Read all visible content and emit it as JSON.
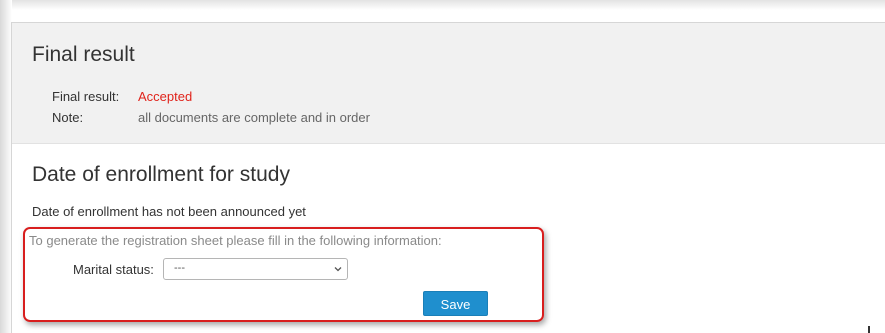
{
  "final_result": {
    "title": "Final result",
    "result_label": "Final result:",
    "result_value": "Accepted",
    "note_label": "Note:",
    "note_value": "all documents are complete and in order"
  },
  "enrollment": {
    "title": "Date of enrollment for study",
    "announce_text": "Date of enrollment has not been announced yet",
    "generate_text": "To generate the registration sheet please fill in the following information:",
    "marital_label": "Marital status:",
    "marital_value": "---",
    "save_label": "Save"
  },
  "colors": {
    "accepted": "#e0241c",
    "save_button": "#1f8fce",
    "highlight_border": "#d81e1e",
    "section_bg": "#f1f1f1"
  },
  "icons": {
    "select_arrow": "chevron-down-icon"
  }
}
